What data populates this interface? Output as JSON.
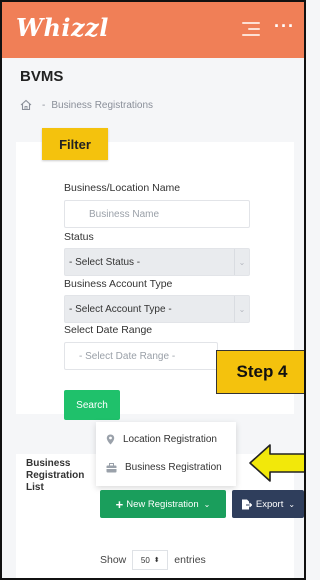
{
  "app": {
    "logo": "Whizzl"
  },
  "header": {
    "more_icon": "ellipsis-icon",
    "menu_icon": "menu-icon"
  },
  "page": {
    "title": "BVMS"
  },
  "breadcrumb": {
    "separator": "-",
    "current": "Business Registrations"
  },
  "filter": {
    "tag": "Filter",
    "name_label": "Business/Location Name",
    "name_placeholder": "Business Name",
    "status_label": "Status",
    "status_value": "- Select Status -",
    "account_type_label": "Business Account Type",
    "account_type_value": "- Select Account Type -",
    "date_label": "Select Date Range",
    "date_placeholder": "- Select Date Range -",
    "search_label": "Search"
  },
  "annotation": {
    "step_label": "Step 4",
    "arrow_color": "#f2e80a"
  },
  "dropdown": {
    "items": [
      {
        "label": "Location Registration",
        "icon": "location-pin-icon"
      },
      {
        "label": "Business Registration",
        "icon": "briefcase-icon"
      }
    ]
  },
  "list": {
    "title": "Business Registration List",
    "new_registration_label": "New Registration",
    "export_label": "Export",
    "show_label": "Show",
    "entries_value": "50",
    "entries_label": "entries"
  },
  "colors": {
    "brand": "#f07f57",
    "primary_button": "#1a9e5c",
    "search_button": "#1fc16b",
    "export_button": "#2f3e5c",
    "highlight": "#f4c20d"
  }
}
